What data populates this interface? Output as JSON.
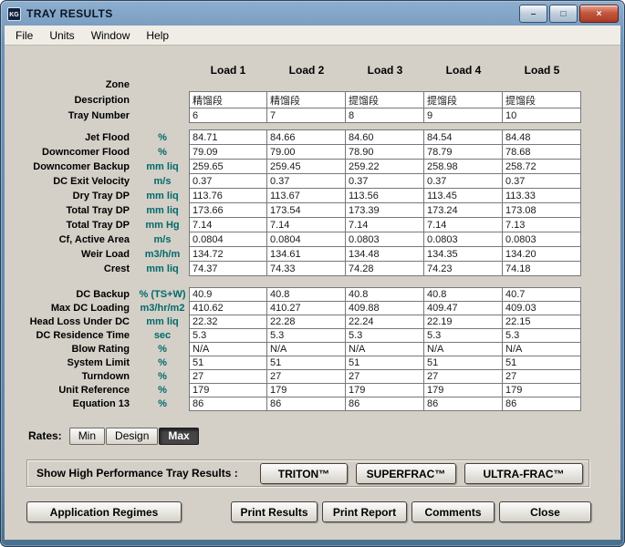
{
  "window": {
    "title": "TRAY RESULTS",
    "icon_text": "KG",
    "controls": {
      "minimize": "–",
      "maximize": "□",
      "close": "×"
    }
  },
  "menu": {
    "items": [
      "File",
      "Units",
      "Window",
      "Help"
    ]
  },
  "table": {
    "column_headers": [
      "Load 1",
      "Load 2",
      "Load 3",
      "Load 4",
      "Load 5"
    ],
    "zone_label": "Zone",
    "head_rows": [
      {
        "label": "Description",
        "unit": "",
        "values": [
          "精馏段",
          "精馏段",
          "提馏段",
          "提馏段",
          "提馏段"
        ]
      },
      {
        "label": "Tray Number",
        "unit": "",
        "values": [
          "6",
          "7",
          "8",
          "9",
          "10"
        ]
      }
    ],
    "section1": [
      {
        "label": "Jet Flood",
        "unit": "%",
        "values": [
          "84.71",
          "84.66",
          "84.60",
          "84.54",
          "84.48"
        ]
      },
      {
        "label": "Downcomer Flood",
        "unit": "%",
        "values": [
          "79.09",
          "79.00",
          "78.90",
          "78.79",
          "78.68"
        ]
      },
      {
        "label": "Downcomer Backup",
        "unit": "mm liq",
        "values": [
          "259.65",
          "259.45",
          "259.22",
          "258.98",
          "258.72"
        ]
      },
      {
        "label": "DC Exit Velocity",
        "unit": "m/s",
        "values": [
          "0.37",
          "0.37",
          "0.37",
          "0.37",
          "0.37"
        ]
      },
      {
        "label": "Dry Tray DP",
        "unit": "mm liq",
        "values": [
          "113.76",
          "113.67",
          "113.56",
          "113.45",
          "113.33"
        ]
      },
      {
        "label": "Total Tray DP",
        "unit": "mm liq",
        "values": [
          "173.66",
          "173.54",
          "173.39",
          "173.24",
          "173.08"
        ]
      },
      {
        "label": "Total Tray DP",
        "unit": "mm Hg",
        "values": [
          "7.14",
          "7.14",
          "7.14",
          "7.14",
          "7.13"
        ]
      },
      {
        "label": "Cf, Active Area",
        "unit": "m/s",
        "values": [
          "0.0804",
          "0.0804",
          "0.0803",
          "0.0803",
          "0.0803"
        ]
      },
      {
        "label": "Weir Load",
        "unit": "m3/h/m",
        "values": [
          "134.72",
          "134.61",
          "134.48",
          "134.35",
          "134.20"
        ]
      },
      {
        "label": "Crest",
        "unit": "mm liq",
        "values": [
          "74.37",
          "74.33",
          "74.28",
          "74.23",
          "74.18"
        ]
      }
    ],
    "section2": [
      {
        "label": "DC Backup",
        "unit": "% (TS+W)",
        "values": [
          "40.9",
          "40.8",
          "40.8",
          "40.8",
          "40.7"
        ]
      },
      {
        "label": "Max DC Loading",
        "unit": "m3/hr/m2",
        "values": [
          "410.62",
          "410.27",
          "409.88",
          "409.47",
          "409.03"
        ]
      },
      {
        "label": "Head Loss Under DC",
        "unit": "mm liq",
        "values": [
          "22.32",
          "22.28",
          "22.24",
          "22.19",
          "22.15"
        ]
      },
      {
        "label": "DC Residence Time",
        "unit": "sec",
        "values": [
          "5.3",
          "5.3",
          "5.3",
          "5.3",
          "5.3"
        ]
      },
      {
        "label": "Blow Rating",
        "unit": "%",
        "values": [
          "N/A",
          "N/A",
          "N/A",
          "N/A",
          "N/A"
        ]
      },
      {
        "label": "System Limit",
        "unit": "%",
        "values": [
          "51",
          "51",
          "51",
          "51",
          "51"
        ]
      },
      {
        "label": "Turndown",
        "unit": "%",
        "values": [
          "27",
          "27",
          "27",
          "27",
          "27"
        ]
      },
      {
        "label": "Unit Reference",
        "unit": "%",
        "values": [
          "179",
          "179",
          "179",
          "179",
          "179"
        ]
      },
      {
        "label": "Equation 13",
        "unit": "%",
        "values": [
          "86",
          "86",
          "86",
          "86",
          "86"
        ]
      }
    ]
  },
  "rates": {
    "label": "Rates:",
    "selected": "Max",
    "options": [
      {
        "label": "Min",
        "selected": false
      },
      {
        "label": "Design",
        "selected": false
      },
      {
        "label": "Max",
        "selected": true
      }
    ]
  },
  "high_performance": {
    "label": "Show High Performance Tray Results :",
    "buttons": [
      "TRITON™",
      "SUPERFRAC™",
      "ULTRA-FRAC™"
    ]
  },
  "footer_buttons": [
    "Application Regimes",
    "Print Results",
    "Print Report",
    "Comments",
    "Close"
  ]
}
